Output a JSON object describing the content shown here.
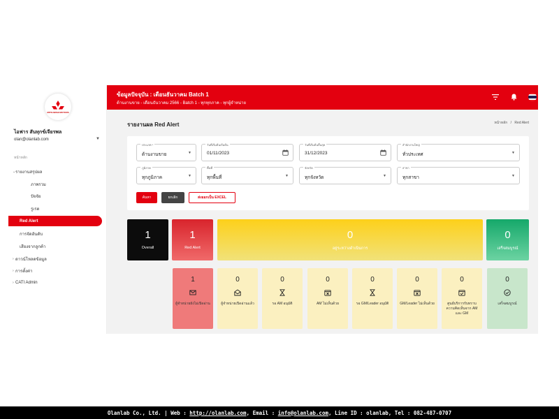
{
  "sidebar": {
    "logo_text": "MITSUBISHI MOTORS",
    "user_name": "ไอฟาร สันทุกข์เจียรพล",
    "user_email": "olan@olanlab.com",
    "section_label": "หน้าหลัก",
    "items": [
      {
        "label": "รายงานสรุปผล",
        "chevron": "⌄"
      },
      {
        "label": "ภาพรวม"
      },
      {
        "label": "ปัจจัย"
      },
      {
        "label": "รูเรต"
      },
      {
        "label": "Red Alert"
      },
      {
        "label": "การจัดอันดับ"
      },
      {
        "label": "เสียงจากลูกค้า"
      },
      {
        "label": "ดาวน์โหลดข้อมูล",
        "chevron": "›"
      },
      {
        "label": "การตั้งค่า",
        "chevron": "›"
      },
      {
        "label": "CATI Admin",
        "chevron": "›"
      }
    ]
  },
  "header": {
    "title": "ข้อมูลปัจจุบัน : เดือนธันวาคม Batch 1",
    "subtitle": "ด้านงานขาย - เดือนธันวาคม 2566 - Batch 1 - ทุกทุกภาค - ทุกผู้จำหน่าย",
    "colors": {
      "brand": "#e3000f"
    }
  },
  "page": {
    "title": "รายงานผล Red Alert",
    "breadcrumb_home": "หน้าหลัก",
    "breadcrumb_sep": "/",
    "breadcrumb_current": "Red Alert"
  },
  "filters": {
    "row1": [
      {
        "label": "ประเภท *",
        "value": "ด้านงานขาย",
        "control": "select"
      },
      {
        "label": "วันที่เริ่มต้นเริ่มต้น",
        "value": "01/11/2023",
        "control": "date"
      },
      {
        "label": "วันที่เริ่มต้นสิ้นสุด",
        "value": "31/12/2023",
        "control": "date"
      },
      {
        "label": "สำนักงานใหญ่",
        "value": "ทั่วประเทศ",
        "control": "select"
      }
    ],
    "row2": [
      {
        "label": "ภูมิภาค",
        "value": "ทุกภูมิภาค",
        "control": "select"
      },
      {
        "label": "พื้นที่",
        "value": "ทุกพื้นที่",
        "control": "select"
      },
      {
        "label": "จังหวัด",
        "value": "ทุกจังหวัด",
        "control": "select"
      },
      {
        "label": "สาขา",
        "value": "ทุกสาขา",
        "control": "select"
      }
    ],
    "buttons": {
      "search": "ค้นหา",
      "cancel": "ยกเลิก",
      "export": "ส่งออกเป็น EXCEL"
    }
  },
  "summary": [
    {
      "value": "1",
      "label": "Overall"
    },
    {
      "value": "1",
      "label": "Red Alert"
    },
    {
      "value": "0",
      "label": "อยู่ระหว่างดำเนินการ"
    },
    {
      "value": "0",
      "label": "เสร็จสมบูรณ์"
    }
  ],
  "status_cards": [
    {
      "value": "1",
      "icon": "mail-icon",
      "label": "ผู้จำหน่ายยังไม่เปิดอ่าน"
    },
    {
      "value": "0",
      "icon": "mail-open-icon",
      "label": "ผู้จำหน่ายเปิดอ่านแล้ว"
    },
    {
      "value": "0",
      "icon": "hourglass-icon",
      "label": "รอ AM อนุมัติ"
    },
    {
      "value": "0",
      "icon": "calendar-x-icon",
      "label": "AM ไม่เห็นด้วย"
    },
    {
      "value": "0",
      "icon": "hourglass-icon",
      "label": "รอ GM/Leader อนุมัติ"
    },
    {
      "value": "0",
      "icon": "calendar-x-icon",
      "label": "GM/Leader ไม่เห็นด้วย"
    },
    {
      "value": "0",
      "icon": "calendar-check-icon",
      "label": "ศูนย์บริการรับทราบความคิดเห็นจาก AM และ GM"
    },
    {
      "value": "0",
      "icon": "check-circle-icon",
      "label": "เสร็จสมบูรณ์"
    }
  ],
  "footer": {
    "prefix": "Olanlab Co., Ltd. | Web : ",
    "web": "http://olanlab.com",
    "email_label": ", Email : ",
    "email": "info@olanlab.com",
    "suffix": ", Line ID : olanlab, Tel : 082-487-0707"
  }
}
